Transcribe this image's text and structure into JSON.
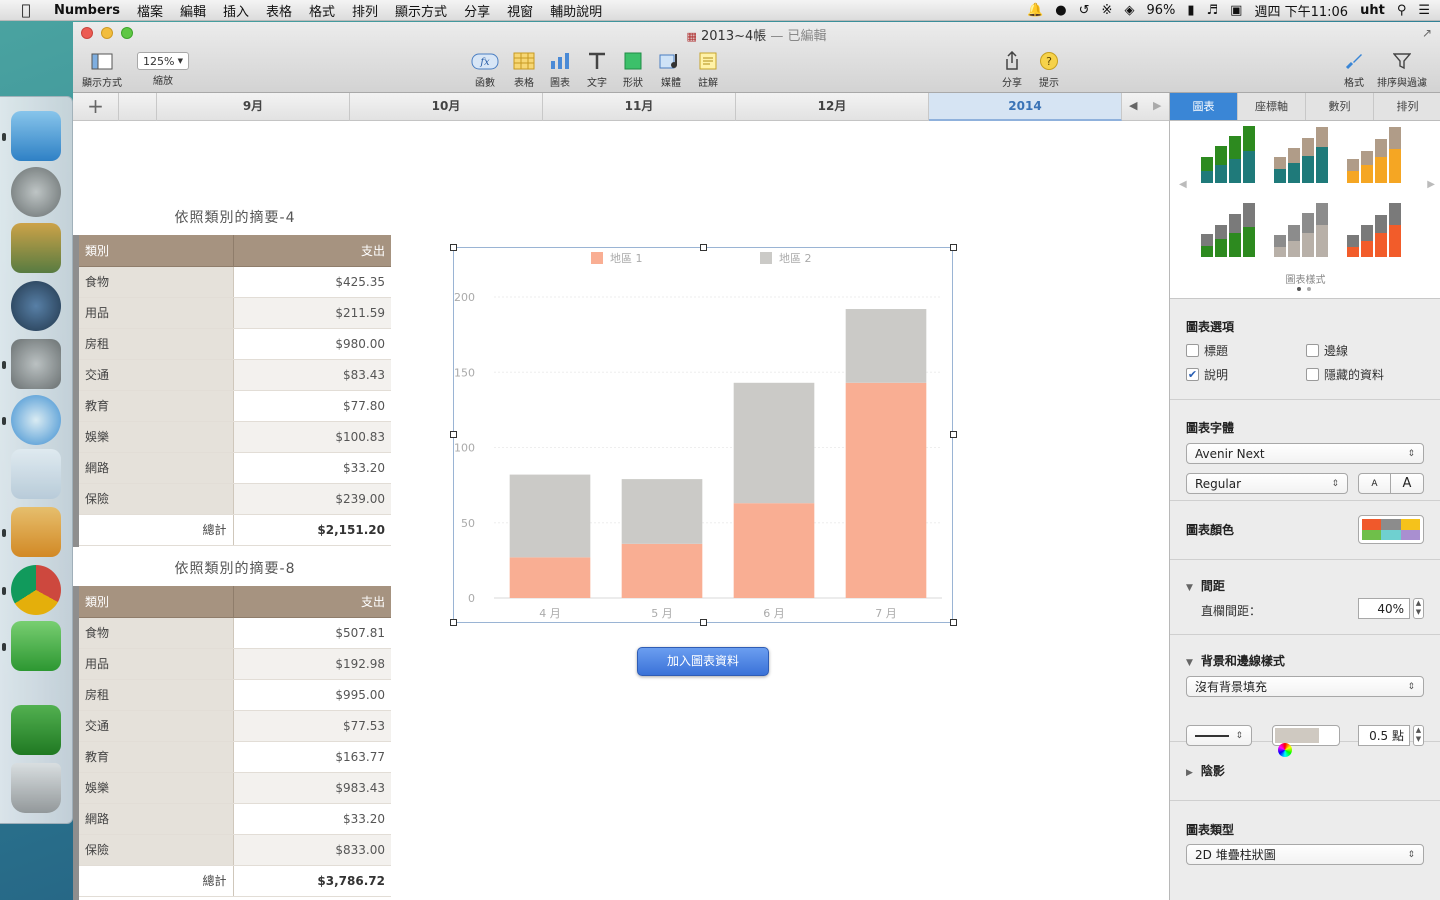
{
  "menubar": {
    "app_name": "Numbers",
    "items": [
      "檔案",
      "編輯",
      "插入",
      "表格",
      "格式",
      "排列",
      "顯示方式",
      "分享",
      "視窗",
      "輔助說明"
    ],
    "battery": "96%",
    "datetime": "週四 下午11:06",
    "user": "uht"
  },
  "window": {
    "title": "2013~4帳",
    "edited": "— 已編輯"
  },
  "toolbar": {
    "view_label": "顯示方式",
    "zoom_value": "125%",
    "zoom_label": "縮放",
    "function_label": "函數",
    "table_label": "表格",
    "chart_label": "圖表",
    "text_label": "文字",
    "shape_label": "形狀",
    "media_label": "媒體",
    "comment_label": "註解",
    "share_label": "分享",
    "tips_label": "提示",
    "format_label": "格式",
    "sort_filter_label": "排序與過濾"
  },
  "sheets": {
    "tabs": [
      "9月",
      "10月",
      "11月",
      "12月",
      "2014"
    ],
    "active": "2014"
  },
  "tables": [
    {
      "title": "依照類別的摘要-4",
      "header_category": "類別",
      "header_amount": "支出",
      "rows": [
        {
          "category": "食物",
          "amount": "$425.35"
        },
        {
          "category": "用品",
          "amount": "$211.59"
        },
        {
          "category": "房租",
          "amount": "$980.00"
        },
        {
          "category": "交通",
          "amount": "$83.43"
        },
        {
          "category": "教育",
          "amount": "$77.80"
        },
        {
          "category": "娛樂",
          "amount": "$100.83"
        },
        {
          "category": "網路",
          "amount": "$33.20"
        },
        {
          "category": "保險",
          "amount": "$239.00"
        }
      ],
      "total_label": "總計",
      "total_value": "$2,151.20"
    },
    {
      "title": "依照類別的摘要-8",
      "header_category": "類別",
      "header_amount": "支出",
      "rows": [
        {
          "category": "食物",
          "amount": "$507.81"
        },
        {
          "category": "用品",
          "amount": "$192.98"
        },
        {
          "category": "房租",
          "amount": "$995.00"
        },
        {
          "category": "交通",
          "amount": "$77.53"
        },
        {
          "category": "教育",
          "amount": "$163.77"
        },
        {
          "category": "娛樂",
          "amount": "$983.43"
        },
        {
          "category": "網路",
          "amount": "$33.20"
        },
        {
          "category": "保險",
          "amount": "$833.00"
        }
      ],
      "total_label": "總計",
      "total_value": "$3,786.72"
    }
  ],
  "chart_data": {
    "type": "bar",
    "stacked": true,
    "categories": [
      "4 月",
      "5 月",
      "6 月",
      "7 月"
    ],
    "series": [
      {
        "name": "地區 1",
        "values": [
          27,
          36,
          63,
          143
        ],
        "color": "#f9ae93"
      },
      {
        "name": "地區 2",
        "values": [
          55,
          43,
          80,
          49
        ],
        "color": "#cbcac7"
      }
    ],
    "yticks": [
      0,
      50,
      100,
      150,
      200
    ],
    "ylim": [
      0,
      200
    ],
    "grid": true,
    "legend": "top"
  },
  "add_chart_data_button": "加入圖表資料",
  "inspector": {
    "tabs": [
      "圖表",
      "座標軸",
      "數列",
      "排列"
    ],
    "active_tab": "圖表",
    "chart_styles_label": "圖表樣式",
    "chart_options_title": "圖表選項",
    "opt_title": "標題",
    "opt_border": "邊線",
    "opt_legend": "說明",
    "opt_hidden": "隱藏的資料",
    "chart_font_title": "圖表字體",
    "font_family": "Avenir Next",
    "font_style": "Regular",
    "font_small": "A",
    "font_large": "A",
    "chart_colors_title": "圖表顏色",
    "gap_title": "間距",
    "column_gap_label": "直欄間距：",
    "column_gap_value": "40%",
    "background_title": "背景和邊線樣式",
    "background_fill": "沒有背景填充",
    "stroke_width": "0.5 點",
    "shadow_title": "陰影",
    "chart_type_title": "圖表類型",
    "chart_type": "2D 堆疊柱狀圖"
  }
}
